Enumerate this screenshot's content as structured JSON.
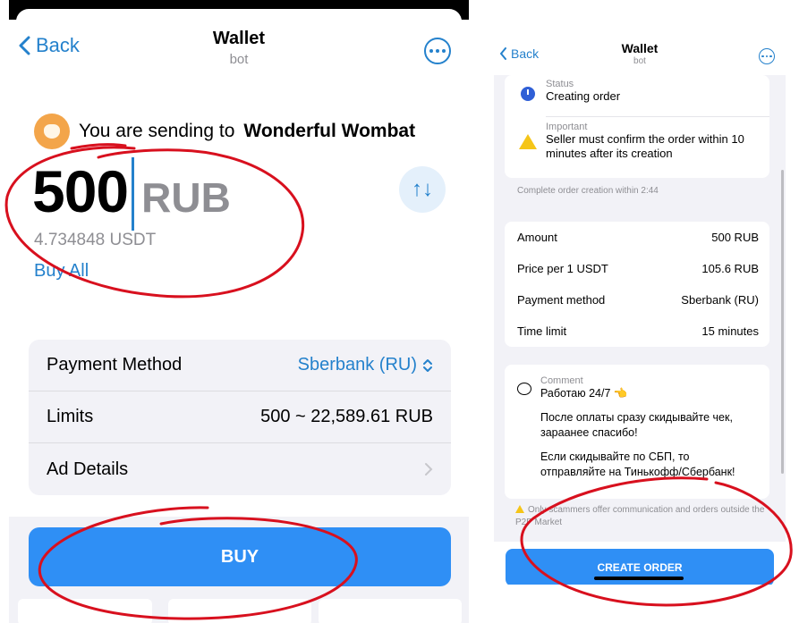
{
  "left": {
    "nav": {
      "back": "Back",
      "title": "Wallet",
      "subtitle": "bot"
    },
    "send": {
      "prefix": "You are sending to",
      "recipient": "Wonderful Wombat"
    },
    "amount": {
      "value": "500",
      "currency": "RUB",
      "converted": "4.734848 USDT",
      "buy_all": "Buy All"
    },
    "swap_icon": "↑↓",
    "rows": [
      {
        "label": "Payment Method",
        "value": "Sberbank (RU)"
      },
      {
        "label": "Limits",
        "value": "500 ~ 22,589.61 RUB"
      },
      {
        "label": "Ad Details",
        "value": ""
      }
    ],
    "buy_button": "BUY"
  },
  "right": {
    "nav": {
      "back": "Back",
      "title": "Wallet",
      "subtitle": "bot"
    },
    "status": {
      "label": "Status",
      "value": "Creating order"
    },
    "important": {
      "label": "Important",
      "value": "Seller must confirm the order within 10 minutes after its creation"
    },
    "hint": "Complete order creation within 2:44",
    "details": [
      {
        "label": "Amount",
        "value": "500 RUB"
      },
      {
        "label": "Price per 1 USDT",
        "value": "105.6 RUB"
      },
      {
        "label": "Payment method",
        "value": "Sberbank (RU)"
      },
      {
        "label": "Time limit",
        "value": "15 minutes"
      }
    ],
    "comment": {
      "label": "Comment",
      "line1": "Работаю 24/7 👈",
      "line2": "После оплаты сразу скидывайте чек, зараанее спасибо!",
      "line3": "Если скидывайте по СБП, то отправляйте на Тинькофф/Сбербанк!"
    },
    "warning": "Only scammers offer communication and orders outside the P2P Market",
    "create_button": "CREATE ORDER"
  },
  "colors": {
    "accent": "#2481cc",
    "button": "#2f8ff5",
    "annotation": "#d8101e"
  }
}
